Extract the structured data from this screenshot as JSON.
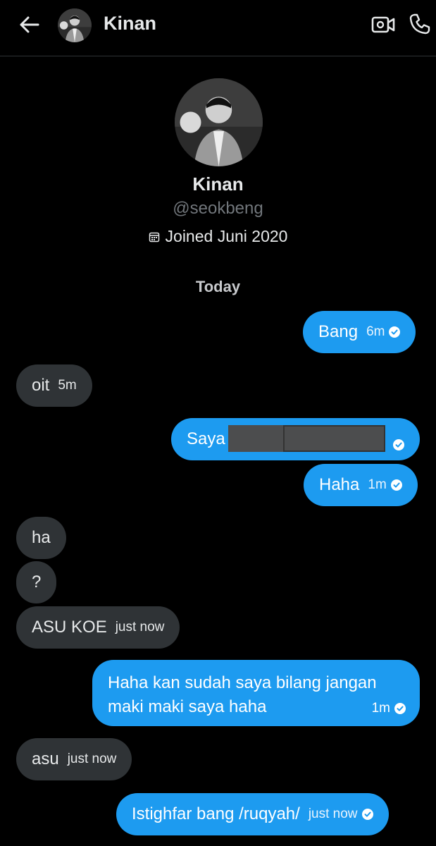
{
  "header": {
    "title": "Kinan",
    "back_icon": "arrow-left-icon",
    "video_icon": "video-call-icon",
    "phone_icon": "phone-icon"
  },
  "profile": {
    "name": "Kinan",
    "handle": "@seokbeng",
    "joined": "Joined Juni 2020"
  },
  "date_separator": "Today",
  "messages": [
    {
      "side": "out",
      "text": "Bang",
      "time": "6m",
      "read": true
    },
    {
      "side": "in",
      "text": "oit",
      "time": "5m"
    },
    {
      "side": "out",
      "text": "Saya",
      "time": "",
      "read": true,
      "redacted": true
    },
    {
      "side": "out",
      "text": "Haha",
      "time": "1m",
      "read": true
    },
    {
      "side": "in",
      "text": "ha",
      "time": ""
    },
    {
      "side": "in",
      "text": "?",
      "time": ""
    },
    {
      "side": "in",
      "text": "ASU KOE",
      "time": "just now"
    },
    {
      "side": "out",
      "text": "Haha kan sudah saya bilang jangan maki maki saya haha",
      "time": "1m",
      "read": true
    },
    {
      "side": "in",
      "text": "asu",
      "time": "just now"
    },
    {
      "side": "out",
      "text": "Istighfar bang /ruqyah/",
      "time": "just now",
      "read": true
    }
  ],
  "colors": {
    "background": "#000000",
    "outgoing_bubble": "#1d9bf0",
    "incoming_bubble": "#2f3336",
    "muted_text": "#71767b"
  }
}
